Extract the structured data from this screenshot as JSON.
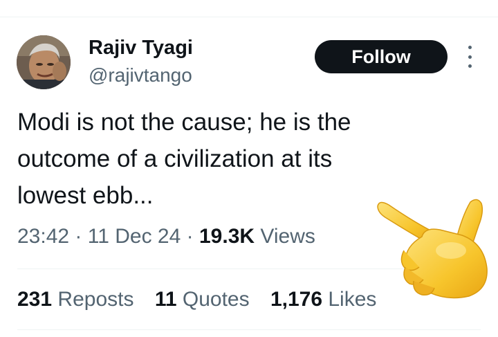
{
  "tweet": {
    "author_name": "Rajiv Tyagi",
    "author_handle": "@rajivtango",
    "follow_label": "Follow",
    "text_lines": [
      "Modi is not the cause; he is the",
      "outcome of a civilization at its",
      "lowest ebb..."
    ],
    "time": "23:42",
    "date": "11 Dec 24",
    "separator": "·",
    "views_count": "19.3K",
    "views_label": "Views",
    "stats": {
      "reposts_count": "231",
      "reposts_label": "Reposts",
      "quotes_count": "11",
      "quotes_label": "Quotes",
      "likes_count": "1,176",
      "likes_label": "Likes"
    }
  },
  "icons": {
    "more": "more-vertical-icon",
    "overlay": "backhand-index-pointing-left-emoji"
  },
  "colors": {
    "text_primary": "#0f1419",
    "text_secondary": "#536471",
    "follow_bg": "#0f1419",
    "follow_text": "#ffffff",
    "divider": "#eff3f4",
    "emoji_skin": "#f7c52c"
  }
}
